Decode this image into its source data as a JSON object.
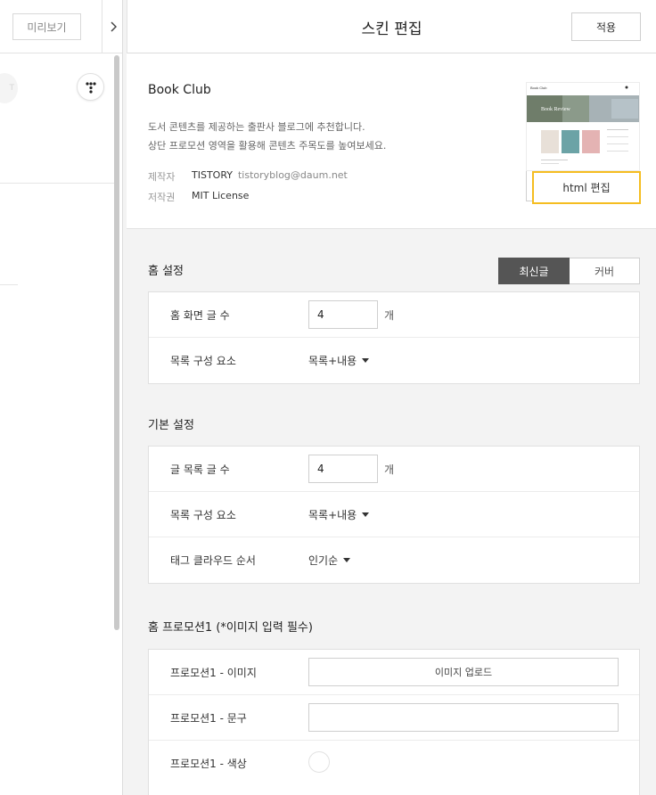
{
  "left_panel": {
    "preview_label": "미리보기",
    "ghost_text": "T"
  },
  "header": {
    "title": "스킨 편집",
    "apply_label": "적용"
  },
  "skin_info": {
    "name": "Book Club",
    "description_line1": "도서 콘텐츠를 제공하는 출판사 블로그에 추천합니다.",
    "description_line2": "상단 프로모션 영역을 활용해 콘텐츠 주목도를 높여보세요.",
    "maker_label": "제작자",
    "maker_name": "TISTORY",
    "maker_email": "tistoryblog@daum.net",
    "license_label": "저작권",
    "license_value": "MIT License",
    "thumbnail_title": "Book Club",
    "thumbnail_banner": "Book Review",
    "html_edit_label": "html 편집"
  },
  "home_settings": {
    "title": "홈 설정",
    "toggle": {
      "latest_label": "최신글",
      "cover_label": "커버",
      "selected": "최신글"
    },
    "posts_label": "홈 화면 글 수",
    "posts_value": "4",
    "posts_unit": "개",
    "list_label": "목록 구성 요소",
    "list_value": "목록+내용"
  },
  "basic_settings": {
    "title": "기본 설정",
    "posts_label": "글 목록 글 수",
    "posts_value": "4",
    "posts_unit": "개",
    "list_label": "목록 구성 요소",
    "list_value": "목록+내용",
    "tag_label": "태그 클라우드 순서",
    "tag_value": "인기순"
  },
  "promotion1": {
    "title": "홈 프로모션1 (*이미지 입력 필수)",
    "image_label": "프로모션1 - 이미지",
    "upload_label": "이미지 업로드",
    "text_label": "프로모션1 - 문구",
    "text_value": "",
    "color_label": "프로모션1 - 색상"
  },
  "colors": {
    "accent_highlight": "#f5bd20",
    "toggle_active": "#555555"
  }
}
